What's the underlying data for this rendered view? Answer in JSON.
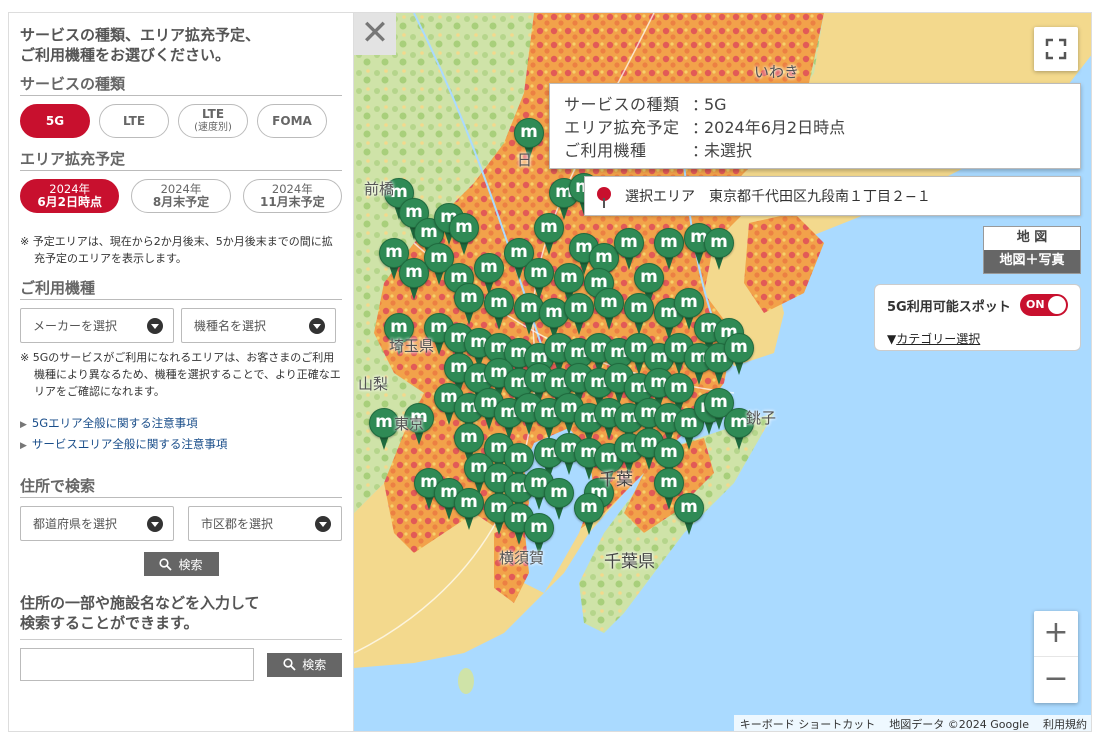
{
  "panel": {
    "intro_line1": "サービスの種類、エリア拡充予定、",
    "intro_line2": "ご利用機種をお選びください。",
    "service_title": "サービスの種類",
    "services": [
      {
        "label": "5G",
        "sub": "",
        "active": true
      },
      {
        "label": "LTE",
        "sub": "",
        "active": false
      },
      {
        "label": "LTE",
        "sub": "(速度別)",
        "active": false
      },
      {
        "label": "FOMA",
        "sub": "",
        "active": false
      }
    ],
    "area_title": "エリア拡充予定",
    "areas": [
      {
        "line1": "2024年",
        "line2": "6月2日時点",
        "active": true
      },
      {
        "line1": "2024年",
        "line2": "8月末予定",
        "active": false
      },
      {
        "line1": "2024年",
        "line2": "11月末予定",
        "active": false
      }
    ],
    "area_note": "※ 予定エリアは、現在から2か月後末、5か月後末までの間に拡充予定のエリアを表示します。",
    "device_title": "ご利用機種",
    "maker_placeholder": "メーカーを選択",
    "model_placeholder": "機種名を選択",
    "device_note": "※ 5Gのサービスがご利用になれるエリアは、お客さまのご利用機種により異なるため、機種を選択することで、より正確なエリアをご確認になれます。",
    "link1": "5Gエリア全般に関する注意事項",
    "link2": "サービスエリア全般に関する注意事項",
    "address_title": "住所で検索",
    "pref_placeholder": "都道府県を選択",
    "city_placeholder": "市区郡を選択",
    "search_label": "検索",
    "free_line1": "住所の一部や施設名などを入力して",
    "free_line2": "検索することができます。",
    "free_input_value": "",
    "free_search_label": "検索"
  },
  "map": {
    "close_label": "✕",
    "info": {
      "service_key": "サービスの種類",
      "service_val": "5G",
      "plan_key": "エリア拡充予定",
      "plan_val": "2024年6月2日時点",
      "device_key": "ご利用機種",
      "device_val": "未選択",
      "colon": "："
    },
    "area_label": "選択エリア",
    "area_address": "東京都千代田区九段南１丁目２−１",
    "map_type_map": "地 図",
    "map_type_sat": "地図＋写真",
    "spot_label": "5G利用可能スポット",
    "spot_toggle": "ON",
    "category_prefix": "▼",
    "category_link": "カテゴリー選択",
    "places": [
      {
        "name": "いわき",
        "big": false
      },
      {
        "name": "埼玉県",
        "big": false
      },
      {
        "name": "銚子",
        "big": false
      },
      {
        "name": "千葉",
        "big": true
      },
      {
        "name": "横須賀",
        "big": false
      },
      {
        "name": "千葉県",
        "big": true
      },
      {
        "name": "日",
        "big": false
      },
      {
        "name": "前橋",
        "big": false
      },
      {
        "name": "山梨",
        "big": false
      },
      {
        "name": "東京",
        "big": false
      }
    ],
    "pin_letter": "m",
    "zoom_in": "+",
    "zoom_out": "−",
    "attribution": {
      "shortcuts": "キーボード ショートカット",
      "data": "地図データ ©2024 Google",
      "terms": "利用規約"
    }
  },
  "colors": {
    "accent": "#c8102e",
    "pin": "#2f8a55",
    "coverage": "#e25a57",
    "sea": "#aadaff"
  }
}
